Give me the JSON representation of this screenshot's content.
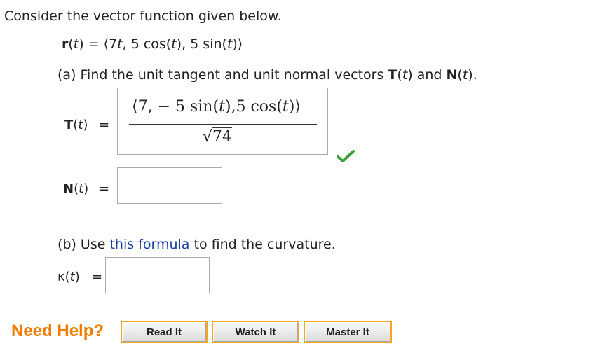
{
  "intro": "Consider the vector function given below.",
  "r_func": {
    "name": "r",
    "open": "(",
    "var": "t",
    "close": ") = ⟨",
    "c1": "7",
    "c1_var": "t",
    "c2": ", 5 cos(",
    "c2_var": "t",
    "c3": "), 5 sin(",
    "c3_var": "t",
    "end": ")⟩"
  },
  "part_a": {
    "pre": "(a) Find the unit tangent and unit normal vectors ",
    "T": "T",
    "paren1_open": "(",
    "var1": "t",
    "paren1_close": ")",
    "and": " and ",
    "N": "N",
    "paren2_open": "(",
    "var2": "t",
    "paren2_close": ")",
    "period": "."
  },
  "T_row": {
    "name": "T",
    "open": "(",
    "var": "t",
    "close": ")",
    "eq": "=",
    "answer_numerator_a": "⟨7, − 5 sin(",
    "answer_numerator_t1": "t",
    "answer_numerator_b": "),5 cos(",
    "answer_numerator_t2": "t",
    "answer_numerator_c": ")⟩",
    "answer_sqrt": "√",
    "answer_radicand": "74",
    "status": "correct"
  },
  "N_row": {
    "name": "N",
    "open": "(",
    "var": "t",
    "close": ")",
    "eq": "=",
    "value": ""
  },
  "part_b": {
    "pre": "(b) Use ",
    "link": "this formula",
    "post": " to find the curvature."
  },
  "kappa_row": {
    "name": "κ",
    "open": "(",
    "var": "t",
    "close": ")",
    "eq": "=",
    "value": ""
  },
  "help": {
    "label": "Need Help?",
    "buttons": [
      "Read It",
      "Watch It",
      "Master It"
    ]
  },
  "colors": {
    "help_orange": "#f07c00",
    "button_border": "#f6a322",
    "link_blue": "#1a3fa6",
    "check_green": "#3aa23a"
  }
}
